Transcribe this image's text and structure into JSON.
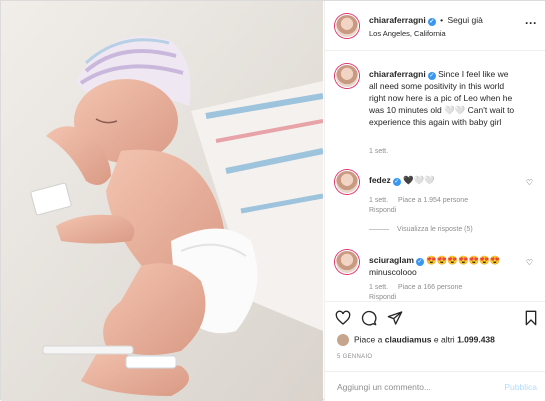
{
  "header": {
    "username": "chiaraferragni",
    "separator": "•",
    "follow_label": "Segui già",
    "location": "Los Angeles, California",
    "more_icon": "more-horizontal-icon"
  },
  "caption": {
    "username": "chiaraferragni",
    "text": "Since I feel like we all need some positivity in this world right now here is a pic of Leo when he was 10 minutes old 🤍🤍 Can't wait to experience this again with baby girl",
    "time": "1 sett."
  },
  "comments": [
    {
      "username": "fedez",
      "text": "🖤🤍🤍",
      "time": "1 sett.",
      "likes": "Piace a 1.954 persone",
      "reply": "Rispondi",
      "view_replies": "Visualizza le risposte (5)"
    },
    {
      "username": "sciuraglam",
      "text": "😍😍😍😍😍😍😍 minuscolooo",
      "time": "1 sett.",
      "likes": "Piace a 166 persone",
      "reply": "Rispondi"
    }
  ],
  "actions": {
    "like_icon": "heart-icon",
    "comment_icon": "comment-icon",
    "share_icon": "share-icon",
    "save_icon": "bookmark-icon"
  },
  "likes": {
    "prefix": "Piace a",
    "users": "claudiamus",
    "suffix": "e altri",
    "count": "1.099.438"
  },
  "date": "5 GENNAIO",
  "add_comment": {
    "placeholder": "Aggiungi un commento...",
    "publish": "Pubblica"
  },
  "colors": {
    "verified": "#3897f0",
    "publish_disabled": "#b3dbff",
    "muted": "#8e8e8e"
  }
}
